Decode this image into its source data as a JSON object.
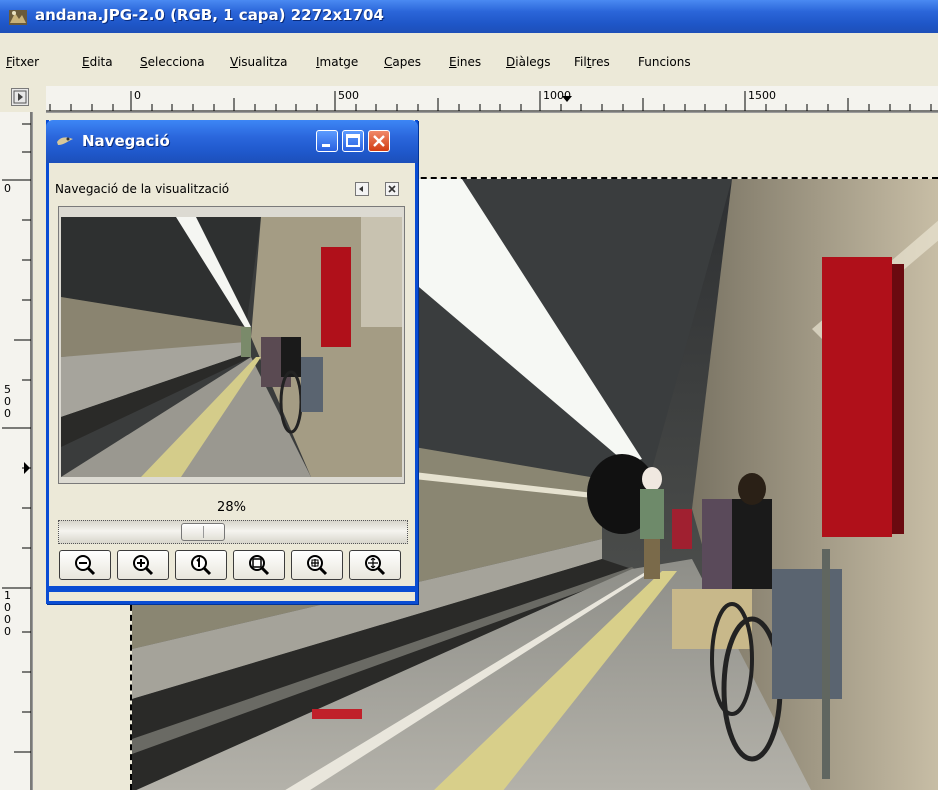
{
  "window": {
    "title": "andana.JPG-2.0 (RGB, 1 capa) 2272x1704"
  },
  "menubar": {
    "items": [
      {
        "label": "Fitxer",
        "mnemonic": "F",
        "rest": "itxer"
      },
      {
        "label": "Edita",
        "mnemonic": "E",
        "rest": "dita"
      },
      {
        "label": "Selecciona",
        "mnemonic": "S",
        "rest": "elecciona"
      },
      {
        "label": "Visualitza",
        "mnemonic": "V",
        "rest": "isualitza"
      },
      {
        "label": "Imatge",
        "mnemonic": "I",
        "rest": "matge"
      },
      {
        "label": "Capes",
        "mnemonic": "C",
        "rest": "apes"
      },
      {
        "label": "Eines",
        "mnemonic": "E",
        "rest": "ines"
      },
      {
        "label": "Diàlegs",
        "mnemonic": "D",
        "rest": "iàlegs"
      },
      {
        "label": "Filtres",
        "pre": "Fil",
        "mnemonic": "t",
        "rest": "res"
      },
      {
        "label": "Funcions"
      }
    ]
  },
  "rulers": {
    "horizontal_labels": [
      "0",
      "500",
      "1000",
      "1500"
    ],
    "vertical_labels": [
      "0",
      "500",
      "1000"
    ]
  },
  "navigation": {
    "window_title": "Navegació",
    "dock_title": "Navegació de la visualització",
    "zoom_percent": "28%",
    "zoom_slider_value": 0.28,
    "buttons": [
      "zoom-out-icon",
      "zoom-in-icon",
      "zoom-1to1-icon",
      "zoom-fit-icon",
      "zoom-fill-icon",
      "shrink-wrap-icon"
    ]
  },
  "colors": {
    "xp_blue": "#245edb",
    "close_red": "#d23d13",
    "canvas_bg": "#ece9d8"
  }
}
